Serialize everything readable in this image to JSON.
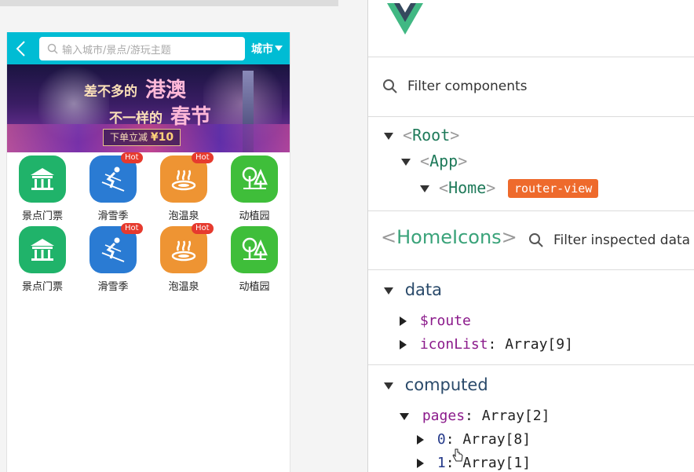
{
  "mobile": {
    "header": {
      "search_placeholder": "输入城市/景点/游玩主题",
      "city_label": "城市"
    },
    "banner": {
      "line1_prefix": "差不多的",
      "line1_big": "港澳",
      "line2_prefix": "不一样的",
      "line2_big": "春节",
      "deal_text": "下单立减",
      "deal_value": "¥10"
    },
    "icons": [
      {
        "label": "景点门票",
        "icon": "pavilion-icon",
        "hot": false
      },
      {
        "label": "滑雪季",
        "icon": "skier-icon",
        "hot": true
      },
      {
        "label": "泡温泉",
        "icon": "hot-spring-icon",
        "hot": true
      },
      {
        "label": "动植园",
        "icon": "trees-icon",
        "hot": false
      },
      {
        "label": "景点门票",
        "icon": "pavilion-icon",
        "hot": false
      },
      {
        "label": "滑雪季",
        "icon": "skier-icon",
        "hot": true
      },
      {
        "label": "泡温泉",
        "icon": "hot-spring-icon",
        "hot": true
      },
      {
        "label": "动植园",
        "icon": "trees-icon",
        "hot": false
      }
    ],
    "hot_label": "Hot",
    "colors": {
      "header": "#00bcd4",
      "hot_badge": "#e63a2e"
    }
  },
  "devtools": {
    "filter_components_placeholder": "Filter components",
    "tree": {
      "root": "Root",
      "app": "App",
      "home": "Home",
      "router_badge": "router-view"
    },
    "inspected_component": "HomeIcons",
    "filter_inspected_placeholder": "Filter inspected data",
    "sections": {
      "data_title": "data",
      "computed_title": "computed"
    },
    "data_props": [
      {
        "key": "$route",
        "value": ""
      },
      {
        "key": "iconList",
        "value": "Array[9]"
      }
    ],
    "computed_props": {
      "pages": {
        "key": "pages",
        "value": "Array[2]"
      },
      "items": [
        {
          "key": "0",
          "value": "Array[8]"
        },
        {
          "key": "1",
          "value": "Array[1]"
        }
      ]
    },
    "colors": {
      "vue_green": "#41b883",
      "vue_dark": "#35495e",
      "badge": "#ee6a2c"
    }
  }
}
